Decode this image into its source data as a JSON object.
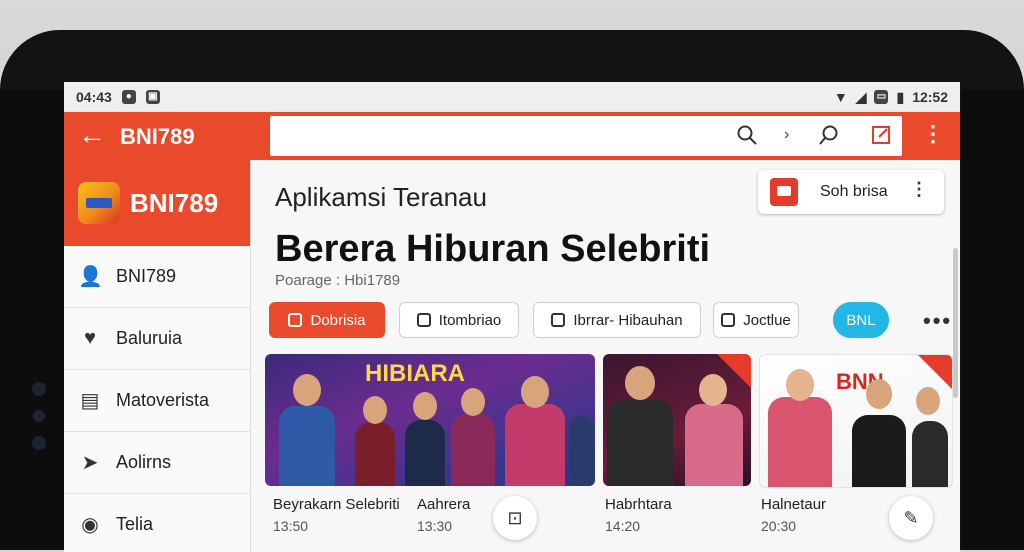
{
  "status_bar": {
    "left_text": "04:43",
    "right_text": "12:52"
  },
  "top_bar": {
    "title": "BNI789"
  },
  "sidebar": {
    "brand": "BNI789",
    "items": [
      {
        "label": "BNI789",
        "icon": "user-icon"
      },
      {
        "label": "Baluruia",
        "icon": "heart-icon"
      },
      {
        "label": "Matoverista",
        "icon": "calendar-icon"
      },
      {
        "label": "Aolirns",
        "icon": "send-icon"
      },
      {
        "label": "Telia",
        "icon": "circle-icon"
      }
    ]
  },
  "main": {
    "app_text": "Aplikamsi Teranau",
    "headline": "Berera Hiburan Selebriti",
    "subtitle": "Poarage : Hbi1789",
    "top_card": {
      "label": "Soh brisa"
    },
    "chips": [
      "Dobrisia",
      "Itombriao",
      "Ibrrar- Hibauhan",
      "Joctlue",
      "BNL"
    ],
    "tiles": [
      {
        "title": "HIBIARA",
        "caption": "Beyrakarn Selebriti",
        "time": "13:50"
      },
      {
        "title": "",
        "caption": "Aahrera",
        "time": "13:30"
      },
      {
        "title": "",
        "caption": "Habrhtara",
        "time": "14:20"
      },
      {
        "title": "BNN",
        "caption": "Halnetaur",
        "time": "20:30"
      }
    ]
  },
  "colors": {
    "accent": "#e94a2c",
    "pill": "#23b7e6"
  }
}
